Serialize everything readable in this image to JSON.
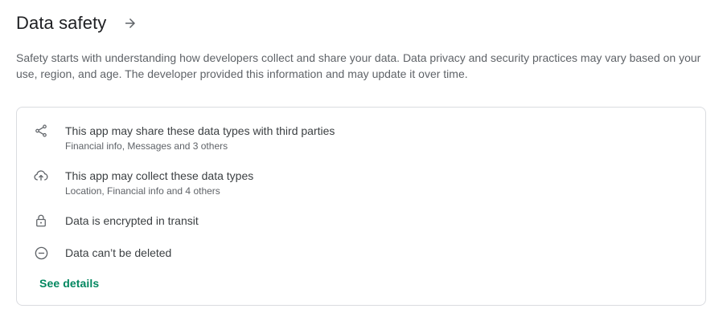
{
  "section": {
    "title": "Data safety",
    "arrow_icon": "arrow-right-icon",
    "description": "Safety starts with understanding how developers collect and share your data. Data privacy and security practices may vary based on your use, region, and age. The developer provided this information and may update it over time."
  },
  "card": {
    "items": [
      {
        "icon": "share-icon",
        "title": "This app may share these data types with third parties",
        "subtitle": "Financial info, Messages and 3 others"
      },
      {
        "icon": "cloud-upload-icon",
        "title": "This app may collect these data types",
        "subtitle": "Location, Financial info and 4 others"
      },
      {
        "icon": "lock-icon",
        "title": "Data is encrypted in transit"
      },
      {
        "icon": "minus-circle-icon",
        "title": "Data can’t be deleted"
      }
    ],
    "see_details_label": "See details"
  },
  "colors": {
    "accent": "#01875f",
    "text_primary": "#202124",
    "text_secondary": "#5f6368",
    "border": "#dadce0"
  }
}
